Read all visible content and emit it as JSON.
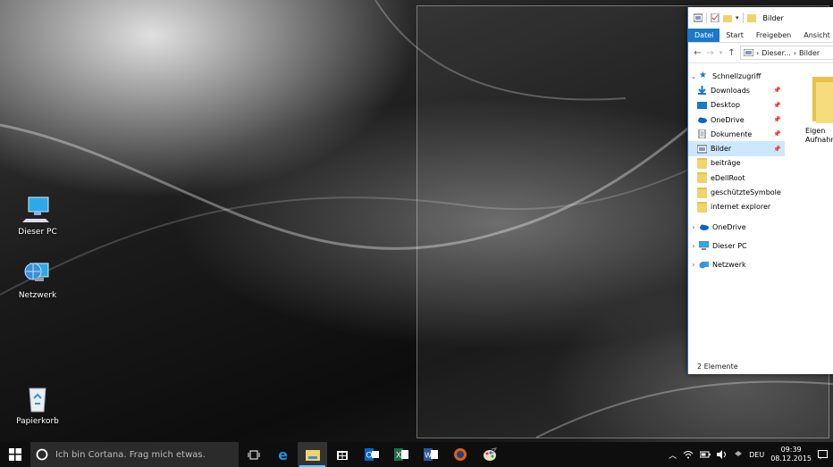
{
  "desktop": {
    "icons": [
      {
        "label": "Dieser PC"
      },
      {
        "label": "Netzwerk"
      },
      {
        "label": "Papierkorb"
      }
    ]
  },
  "explorer": {
    "title": "Bilder",
    "tabs": [
      "Datei",
      "Start",
      "Freigeben",
      "Ansicht"
    ],
    "active_tab": "Datei",
    "address": [
      "Dieser...",
      "Bilder"
    ],
    "nav": {
      "quick_access": "Schnellzugriff",
      "items": [
        {
          "label": "Downloads",
          "icon": "download-icon",
          "pinned": true
        },
        {
          "label": "Desktop",
          "icon": "desktop-icon",
          "pinned": true
        },
        {
          "label": "OneDrive",
          "icon": "onedrive-icon",
          "pinned": true
        },
        {
          "label": "Dokumente",
          "icon": "documents-icon",
          "pinned": true
        },
        {
          "label": "Bilder",
          "icon": "pictures-icon",
          "pinned": true,
          "selected": true
        },
        {
          "label": "beiträge",
          "icon": "folder-icon",
          "pinned": false
        },
        {
          "label": "eDellRoot",
          "icon": "folder-icon",
          "pinned": false
        },
        {
          "label": "geschützteSymbole",
          "icon": "folder-icon",
          "pinned": false
        },
        {
          "label": "internet explorer",
          "icon": "folder-icon",
          "pinned": false
        }
      ],
      "roots": [
        {
          "label": "OneDrive",
          "icon": "onedrive-icon"
        },
        {
          "label": "Dieser PC",
          "icon": "computer-icon"
        },
        {
          "label": "Netzwerk",
          "icon": "network-icon"
        }
      ]
    },
    "content": {
      "folder_label_line1": "Eigen",
      "folder_label_line2": "Aufnahm"
    },
    "status": "2 Elemente"
  },
  "taskbar": {
    "search_placeholder": "Ich bin Cortana. Frag mich etwas.",
    "language": "DEU",
    "time": "09:39",
    "date": "08.12.2015"
  },
  "colors": {
    "accent": "#1979ca",
    "selection": "#cce8ff",
    "folder": "#f2d36b"
  }
}
